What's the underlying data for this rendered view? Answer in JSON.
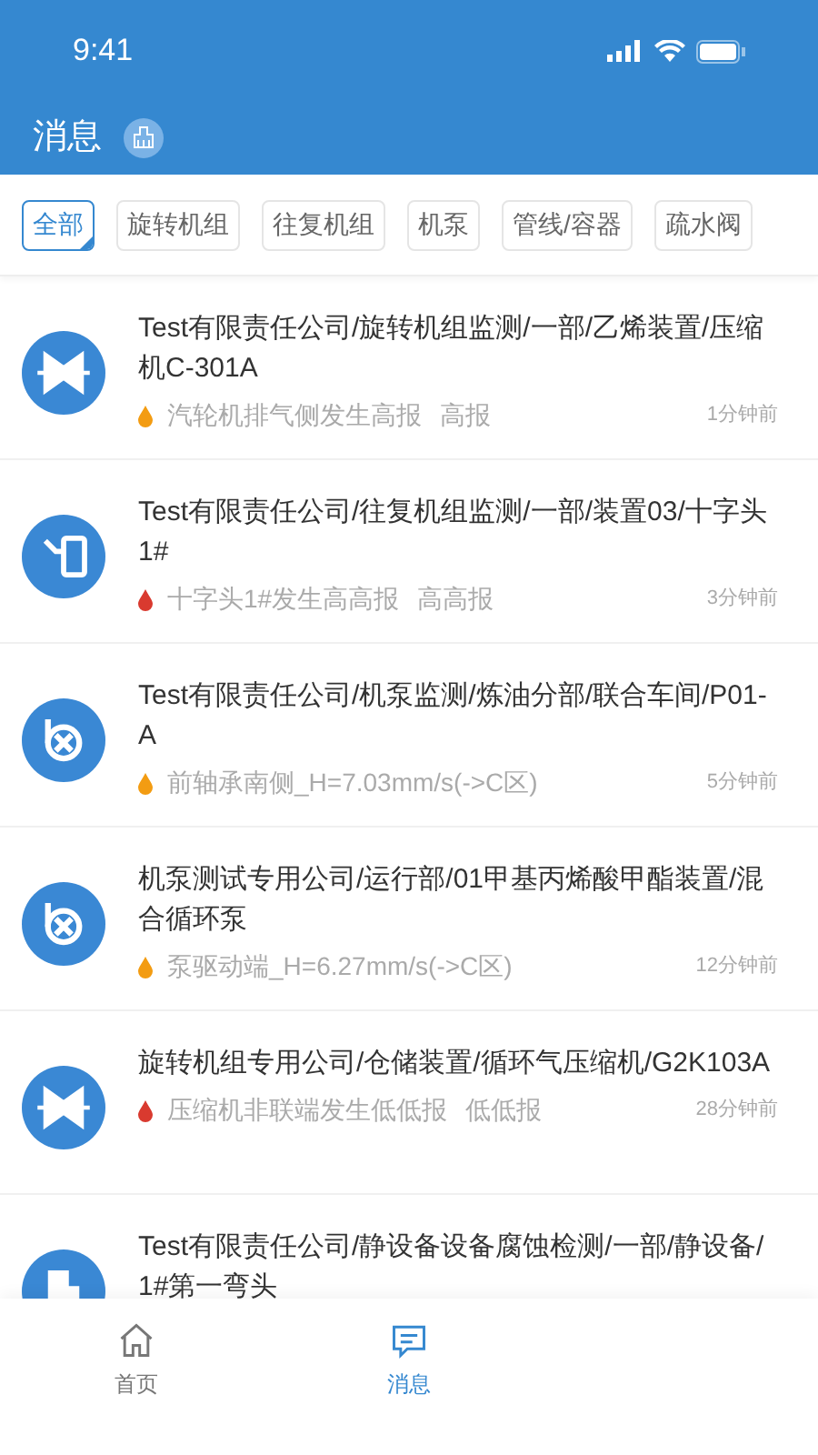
{
  "status_bar": {
    "time": "9:41"
  },
  "header": {
    "title": "消息"
  },
  "filters": [
    {
      "label": "全部",
      "selected": true
    },
    {
      "label": "旋转机组",
      "selected": false
    },
    {
      "label": "往复机组",
      "selected": false
    },
    {
      "label": "机泵",
      "selected": false
    },
    {
      "label": "管线/容器",
      "selected": false
    },
    {
      "label": "疏水阀",
      "selected": false
    }
  ],
  "messages": [
    {
      "kind": "rotating",
      "title": "Test有限责任公司/旋转机组监测/一部/乙烯装置/压缩机C-301A",
      "alarm": "汽轮机排气侧发生高报",
      "alarm_level": "高报",
      "color": "#f39c12",
      "time": "1分钟前"
    },
    {
      "kind": "reciprocating",
      "title": "Test有限责任公司/往复机组监测/一部/装置03/十字头1#",
      "alarm": "十字头1#发生高高报",
      "alarm_level": "高高报",
      "color": "#d93a2f",
      "time": "3分钟前"
    },
    {
      "kind": "pump",
      "title": "Test有限责任公司/机泵监测/炼油分部/联合车间/P01-A",
      "alarm": "前轴承南侧_H=7.03mm/s(->C区)",
      "color": "#f39c12",
      "time": "5分钟前"
    },
    {
      "kind": "pump",
      "title": "机泵测试专用公司/运行部/01甲基丙烯酸甲酯装置/混合循环泵",
      "alarm": "泵驱动端_H=6.27mm/s(->C区)",
      "color": "#f39c12",
      "time": "12分钟前"
    },
    {
      "kind": "rotating",
      "title": "旋转机组专用公司/仓储装置/循环气压缩机/G2K103A",
      "alarm": "压缩机非联端发生低低报",
      "alarm_level": "低低报",
      "color": "#d93a2f",
      "time": "28分钟前"
    },
    {
      "kind": "pipe",
      "title": "Test有限责任公司/静设备设备腐蚀检测/一部/静设备/1#第一弯头"
    }
  ],
  "tab_bar": [
    {
      "kind": "home",
      "label": "首页",
      "selected": false
    },
    {
      "kind": "messages",
      "label": "消息",
      "selected": true
    }
  ]
}
